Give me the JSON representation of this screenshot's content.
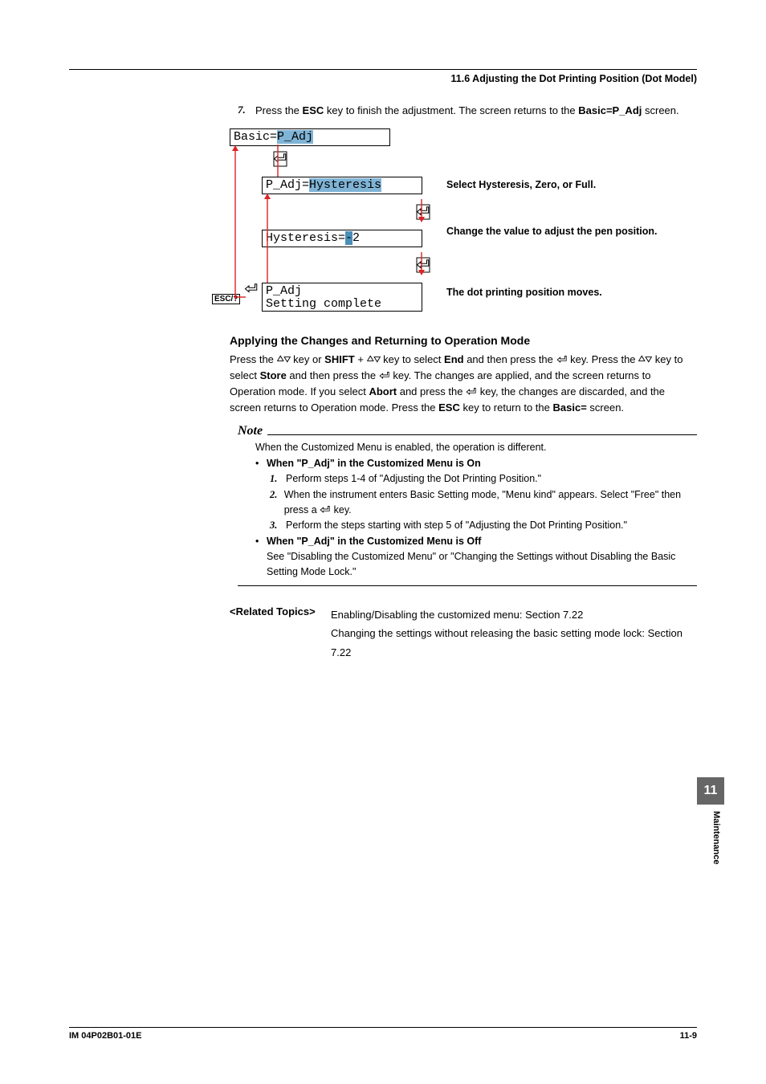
{
  "header": {
    "title": "11.6  Adjusting the Dot Printing Position (Dot Model)"
  },
  "step7": {
    "num": "7.",
    "text_a": "Press the ",
    "esc": "ESC",
    "text_b": " key to finish the adjustment. The screen returns to the ",
    "screen": "Basic=P_Adj",
    "text_c": " screen."
  },
  "diagram": {
    "box1_a": "Basic=",
    "box1_b": "P_Adj",
    "box2_a": "P_Adj=",
    "box2_b": "Hysteresis",
    "box3_a": "Hysteresis=",
    "box3_b": "-",
    "box3_c": "2",
    "box4_l1": "P_Adj",
    "box4_l2": "Setting complete",
    "annot1": "Select  Hysteresis, Zero, or Full.",
    "annot2": "Change the value to adjust the pen position.",
    "annot3": "The dot printing position moves.",
    "esc_label": "ESC/?"
  },
  "section_h": "Applying the Changes and Returning to Operation Mode",
  "para": {
    "t1": "Press the ",
    "t2": " key or ",
    "shift": "SHIFT",
    "t3": " + ",
    "t4": " key to select ",
    "end": "End",
    "t5": " and then press the ",
    "t6": " key.  Press the ",
    "t7": " key to select ",
    "store": "Store",
    "t8": " and then press the ",
    "t9": " key.  The changes are applied, and the screen returns to Operation mode.  If you select ",
    "abort": "Abort",
    "t10": " and press the ",
    "t11": " key, the changes are discarded, and the screen returns to Operation mode.  Press the ",
    "esc": "ESC",
    "t12": " key to return to the ",
    "basic": "Basic=",
    "t13": " screen."
  },
  "note": {
    "title": "Note",
    "intro": "When the Customized Menu is enabled, the operation is different.",
    "b1": "When \"P_Adj\" in the Customized Menu is On",
    "s1_n": "1.",
    "s1": "Perform steps 1-4 of \"Adjusting the Dot Printing Position.\"",
    "s2_n": "2.",
    "s2a": "When the instrument enters Basic Setting mode, \"Menu kind\" appears. Select \"Free\" then press a ",
    "s2b": " key.",
    "s3_n": "3.",
    "s3": "Perform the steps starting with step 5 of \"Adjusting the Dot Printing Position.\"",
    "b2": "When \"P_Adj\" in the Customized Menu is Off",
    "b2_body": "See \"Disabling the Customized Menu\" or \"Changing the Settings without Disabling the Basic Setting Mode Lock.\""
  },
  "related": {
    "label": "<Related Topics>",
    "l1": "Enabling/Disabling the customized menu: Section 7.22",
    "l2": "Changing the settings without releasing the basic setting mode lock: Section 7.22"
  },
  "sidetab": {
    "num": "11",
    "label": "Maintenance"
  },
  "footer": {
    "left": "IM 04P02B01-01E",
    "right": "11-9"
  }
}
